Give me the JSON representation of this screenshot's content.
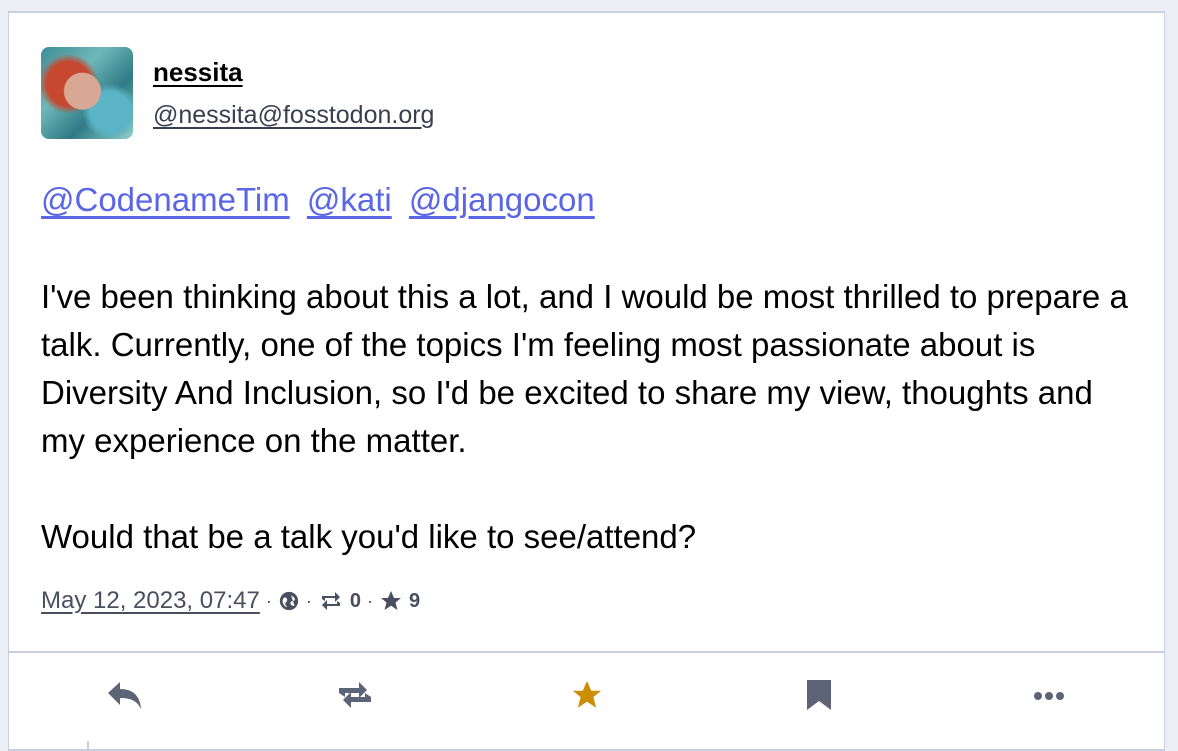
{
  "author": {
    "display_name": "nessita",
    "handle": "@nessita@fosstodon.org"
  },
  "post": {
    "mentions": [
      "@CodenameTim",
      "@kati",
      "@djangocon"
    ],
    "paragraphs": [
      "I've been thinking about this a lot, and I would be most thrilled to prepare a talk. Currently, one of the topics I'm feeling most passionate about is Diversity And Inclusion, so I'd be excited to share my view, thoughts and my experience on the matter.",
      "Would that be a talk you'd like to see/attend?"
    ],
    "timestamp": "May 12, 2023, 07:47",
    "separator": "·",
    "visibility_icon": "globe-icon",
    "boost_count": "0",
    "favourite_count": "9"
  },
  "actions": {
    "icons": [
      "reply-icon",
      "boost-icon",
      "favourite-icon",
      "bookmark-icon",
      "more-icon"
    ]
  },
  "colors": {
    "link": "#5a66e6",
    "muted": "#4a4f60",
    "favourite_active": "#ca8f04",
    "border": "#c9cfe0"
  }
}
